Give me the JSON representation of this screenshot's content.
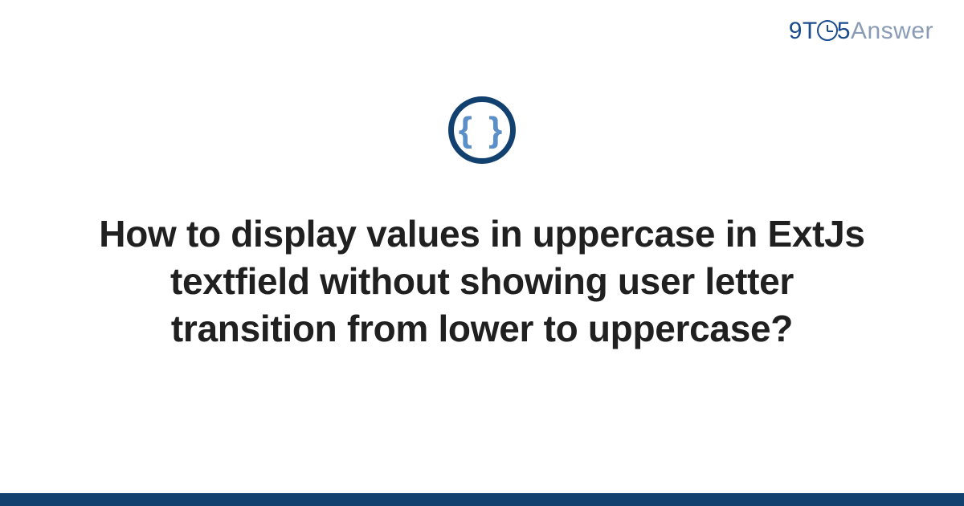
{
  "brand": {
    "prefix": "9T",
    "middle": "5",
    "suffix": "Answer"
  },
  "icon": {
    "symbol": "{ }",
    "name": "braces-icon"
  },
  "title": "How to display values in uppercase in ExtJs textfield without showing user letter transition from lower to uppercase?",
  "colors": {
    "brand_dark": "#12406f",
    "brand_blue": "#1a4b8c",
    "brace_blue": "#5a8fc7",
    "muted": "#8a9cb5",
    "text": "#202020"
  }
}
